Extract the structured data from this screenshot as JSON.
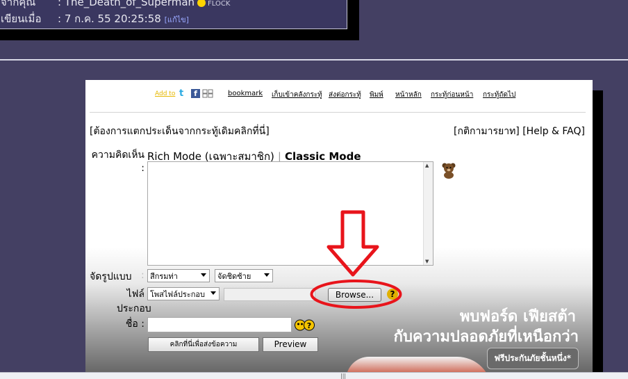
{
  "header": {
    "from_label": "จากคุณ",
    "from_value": ": The_Death_of_Superman",
    "flock_label": "FLOCK",
    "written_label": "เขียนเมื่อ",
    "written_value": ": 7 ก.ค. 55 20:25:58",
    "edit_label": "[แก้ไข]"
  },
  "toolbar": {
    "addto_label": "Add to",
    "links": [
      "bookmark",
      "เก็บเข้าคลังกระทู้",
      "ส่งต่อกระทู้",
      "พิมพ์",
      "หน้าหลัก",
      "กระทู้ก่อนหน้า",
      "กระทู้ถัดไป"
    ]
  },
  "form": {
    "branch_link": "[ต้องการแตกประเด็นจากกระทู้เดิมคลิกที่นี่]",
    "rules_link": "[กติกามารยาท]",
    "help_link": "[Help & FAQ]",
    "opinion_label": "ความคิดเห็น :",
    "rich_mode": "Rich Mode (เฉพาะสมาชิก)",
    "mode_separator": "|",
    "classic_mode": "Classic Mode",
    "format_label": "จัดรูปแบบ",
    "format_colon": ":",
    "font_select": "สีกรมท่า",
    "align_select": "จัดชิดซ้าย",
    "file_label": "ไฟล์ประกอบ",
    "file_colon": ":",
    "file_type_select": "โพสไฟล์ประกอบ",
    "browse_label": "Browse...",
    "help_symbol": "?",
    "name_label": "ชื่อ :",
    "submit_label": "คลิกที่นี่เพื่อส่งข้อความ",
    "preview_label": "Preview"
  },
  "ad": {
    "line1": "พบฟอร์ด เฟียสต้า",
    "line2": "กับความปลอดภัยที่เหนือกว่า",
    "cta": "ฟรีประกันภัยชั้นหนึ่ง*"
  },
  "colors": {
    "page_bg": "#444063",
    "annotation_red": "#e8141b",
    "twitter": "#29a9e1",
    "facebook": "#3b5998"
  },
  "icons": {
    "twitter": "twitter-icon",
    "facebook": "facebook-icon",
    "share": "share-icon",
    "bear": "bear-emoticon-icon",
    "emoji": "emoticon-icon",
    "help": "help-icon"
  },
  "statusbar": {
    "grip": "|||"
  }
}
